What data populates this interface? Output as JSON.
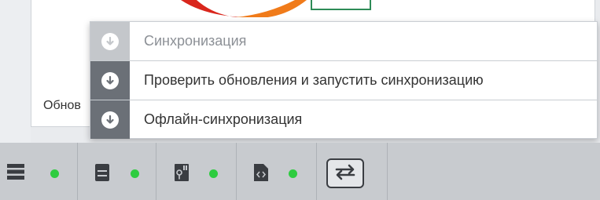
{
  "background": {
    "label": "Обнов"
  },
  "menu": {
    "items": [
      {
        "label": "Синхронизация",
        "icon": "download-circle-icon",
        "disabled": true
      },
      {
        "label": "Проверить обновления и запустить синхронизацию",
        "icon": "download-circle-icon",
        "disabled": false
      },
      {
        "label": "Офлайн-синхронизация",
        "icon": "download-circle-icon",
        "disabled": false
      }
    ]
  },
  "statusbar": {
    "items": [
      {
        "icon": "menu-icon",
        "status_color": "#2ecc40"
      },
      {
        "icon": "server-icon",
        "status_color": "#2ecc40"
      },
      {
        "icon": "database-key-icon",
        "status_color": "#2ecc40"
      },
      {
        "icon": "code-file-icon",
        "status_color": "#2ecc40"
      }
    ],
    "sync_button_icon": "sync-arrows-icon"
  },
  "colors": {
    "accent_green": "#2ecc40",
    "logo_red": "#d9261c",
    "logo_orange": "#f07b1a"
  }
}
